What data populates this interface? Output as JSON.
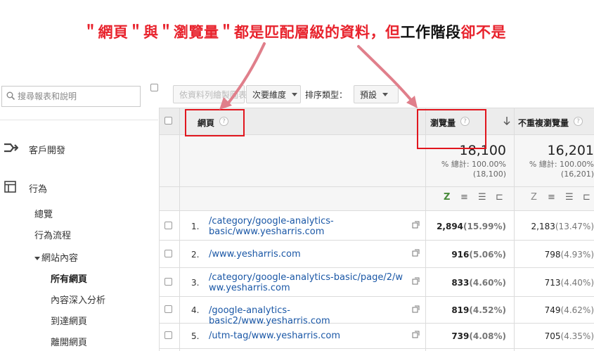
{
  "annotation": {
    "segments": [
      {
        "text": "＂網頁＂與＂瀏覽量＂都是匹配層級的資料，但",
        "color": "red"
      },
      {
        "text": "工作階段",
        "color": "black"
      },
      {
        "text": "卻不是",
        "color": "red"
      }
    ]
  },
  "sidebar": {
    "search_placeholder": "搜尋報表和說明",
    "items": [
      {
        "label": "客戶開發",
        "icon": "acquisition-arrows-icon"
      },
      {
        "label": "行為",
        "icon": "behavior-layout-icon"
      },
      {
        "label": "總覽"
      },
      {
        "label": "行為流程"
      },
      {
        "label": "網站內容",
        "expanded": true
      },
      {
        "label": "所有網頁",
        "active": true
      },
      {
        "label": "內容深入分析"
      },
      {
        "label": "到達網頁"
      },
      {
        "label": "離開網頁"
      }
    ]
  },
  "toolbar": {
    "plot_rows": "依資料列繪製圖表",
    "secondary_dimension": "次要維度",
    "sort_type_label": "排序類型：",
    "sort_type_value": "預設"
  },
  "table": {
    "columns": [
      "網頁",
      "瀏覽量",
      "不重複瀏覽量"
    ],
    "totals": [
      {
        "value": "18,100",
        "pct": "% 總計: 100.00%",
        "of": "(18,100)"
      },
      {
        "value": "16,201",
        "pct": "% 總計: 100.00%",
        "of": "(16,201)"
      }
    ],
    "view_controls": [
      "Z",
      "≡",
      "☰",
      "⊏"
    ],
    "rows": [
      {
        "num": "1.",
        "page": "/category/google-analytics-basic/www.yesharris.com",
        "pv": "2,894",
        "pv_pct": "(15.99%)",
        "upv": "2,183",
        "upv_pct": "(13.47%)"
      },
      {
        "num": "2.",
        "page": "/www.yesharris.com",
        "pv": "916",
        "pv_pct": "(5.06%)",
        "upv": "798",
        "upv_pct": "(4.93%)"
      },
      {
        "num": "3.",
        "page": "/category/google-analytics-basic/page/2/www.yesharris.com",
        "pv": "833",
        "pv_pct": "(4.60%)",
        "upv": "713",
        "upv_pct": "(4.40%)"
      },
      {
        "num": "4.",
        "page": "/google-analytics-basic2/www.yesharris.com",
        "pv": "819",
        "pv_pct": "(4.52%)",
        "upv": "749",
        "upv_pct": "(4.62%)"
      },
      {
        "num": "5.",
        "page": "/utm-tag/www.yesharris.com",
        "pv": "739",
        "pv_pct": "(4.08%)",
        "upv": "705",
        "upv_pct": "(4.35%)"
      }
    ]
  },
  "colors": {
    "annotation_red": "#e8232d",
    "link_blue": "#1a57a6",
    "highlight_box": "#e1161e"
  }
}
